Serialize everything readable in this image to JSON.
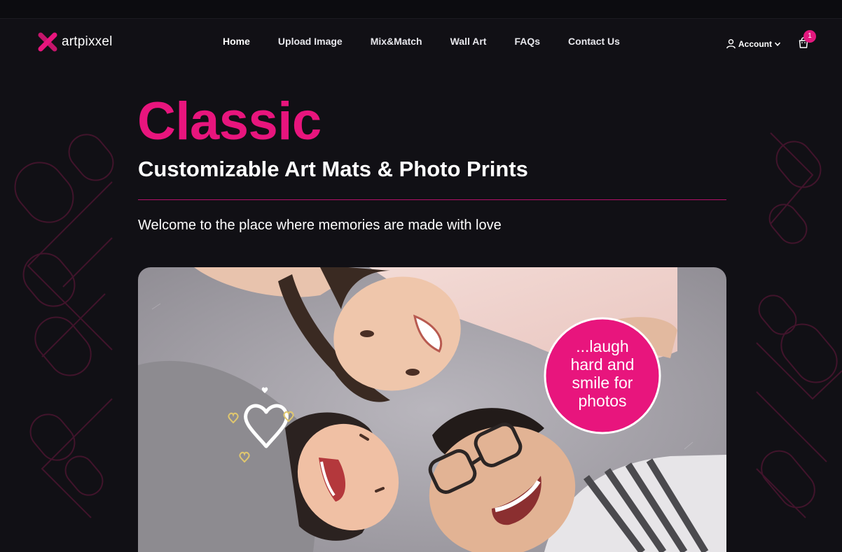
{
  "brand": {
    "name": "artpixxel",
    "accent": "#e8157d",
    "background": "#111015"
  },
  "nav": {
    "items": [
      {
        "label": "Home"
      },
      {
        "label": "Upload Image"
      },
      {
        "label": "Mix&Match"
      },
      {
        "label": "Wall Art"
      },
      {
        "label": "FAQs"
      },
      {
        "label": "Contact Us"
      }
    ]
  },
  "header": {
    "account_label": "Account",
    "cart_count": "1"
  },
  "hero": {
    "title": "Classic",
    "subtitle": "Customizable Art Mats & Photo Prints",
    "tagline": "Welcome to the place where memories are made with love"
  },
  "banner": {
    "bubble_text": [
      "...laugh",
      "hard and",
      "smile for",
      "photos"
    ],
    "bubble_color": "#e8157d"
  }
}
